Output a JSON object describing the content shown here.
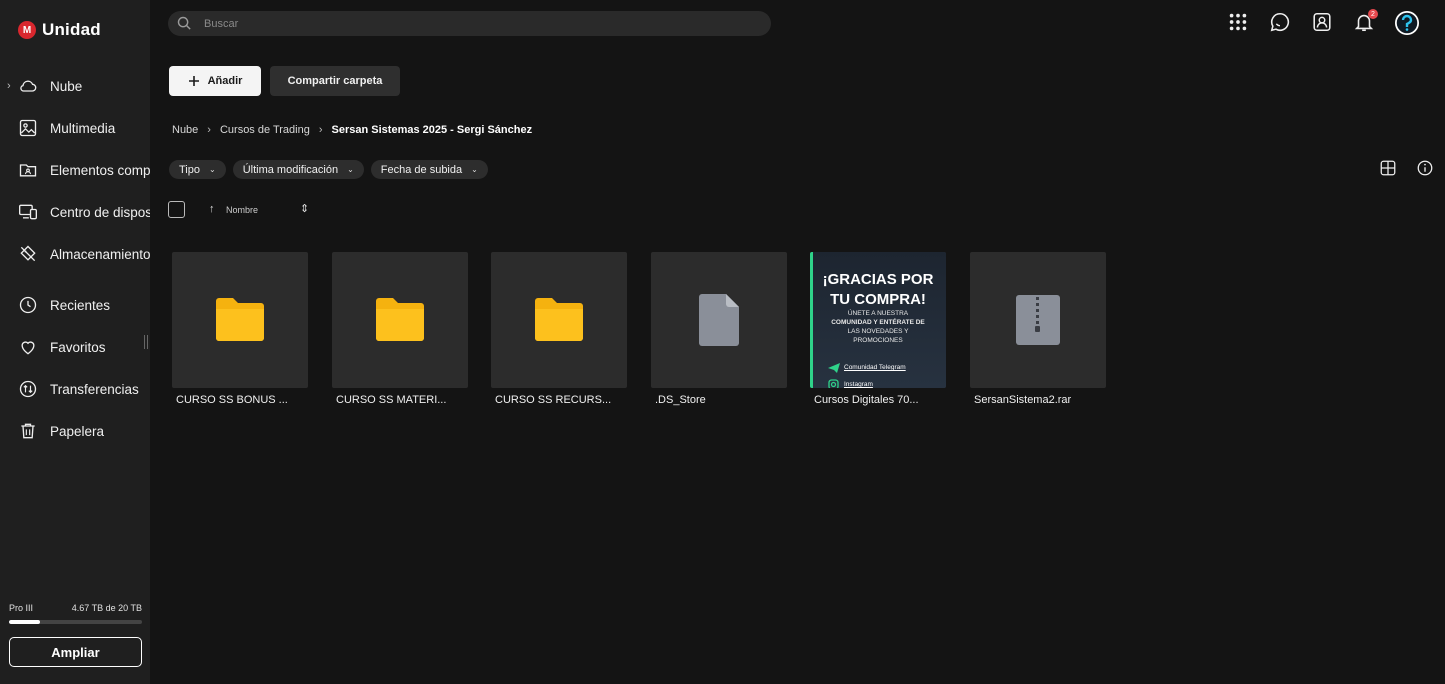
{
  "app": {
    "logo_letter": "M",
    "name": "Unidad"
  },
  "sidebar": {
    "items": [
      {
        "label": "Nube",
        "icon": "cloud-icon",
        "has_chevron": true
      },
      {
        "label": "Multimedia",
        "icon": "image-icon"
      },
      {
        "label": "Elementos compartidos",
        "icon": "shared-folder-icon"
      },
      {
        "label": "Centro de dispositivos",
        "icon": "devices-icon"
      },
      {
        "label": "Almacenamiento",
        "icon": "storage-icon"
      },
      {
        "label": "Recientes",
        "icon": "clock-icon"
      },
      {
        "label": "Favoritos",
        "icon": "heart-icon"
      },
      {
        "label": "Transferencias",
        "icon": "transfer-icon"
      },
      {
        "label": "Papelera",
        "icon": "trash-icon"
      }
    ],
    "storage": {
      "plan": "Pro III",
      "usage_text": "4.67 TB de 20 TB",
      "used_fraction": 0.2335
    },
    "upgrade_label": "Ampliar"
  },
  "search": {
    "placeholder": "Buscar"
  },
  "topbar": {
    "notification_count": "2"
  },
  "actions": {
    "add_label": "Añadir",
    "share_label": "Compartir carpeta"
  },
  "breadcrumb": [
    "Nube",
    "Cursos de Trading",
    "Sersan Sistemas 2025 - Sergi Sánchez"
  ],
  "filters": [
    "Tipo",
    "Última modificación",
    "Fecha de subida"
  ],
  "sort": {
    "label": "Nombre"
  },
  "files": [
    {
      "name": "CURSO SS BONUS ...",
      "kind": "folder"
    },
    {
      "name": "CURSO SS MATERI...",
      "kind": "folder"
    },
    {
      "name": "CURSO SS RECURS...",
      "kind": "folder"
    },
    {
      "name": ".DS_Store",
      "kind": "file"
    },
    {
      "name": "Cursos Digitales 70...",
      "kind": "image"
    },
    {
      "name": "SersanSistema2.rar",
      "kind": "archive"
    }
  ],
  "promo": {
    "heading_1": "¡GRACIAS POR",
    "heading_2": "TU COMPRA!",
    "line_1": "ÚNETE A NUESTRA",
    "line_2": "COMUNIDAD Y ENTÉRATE DE",
    "line_3": "LAS NOVEDADES Y",
    "line_4": "PROMOCIONES",
    "link_1": "Comunidad Telegram",
    "link_2": "Instagram"
  },
  "colors": {
    "background": "#141414",
    "sidebar": "#1f1f1f",
    "brand": "#d9272e",
    "folder": "#f5b20f",
    "badge": "#e5484d"
  }
}
